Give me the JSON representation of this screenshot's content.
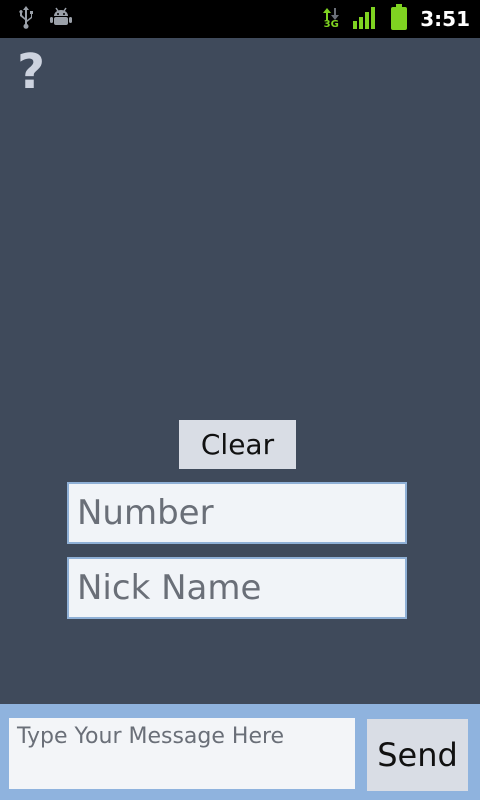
{
  "status_bar": {
    "time": "3:51",
    "network_type": "3G",
    "icons": [
      "usb-icon",
      "debug-icon",
      "data-arrows-icon",
      "signal-icon",
      "battery-icon"
    ],
    "accent_green": "#7fd321"
  },
  "help": {
    "label": "?"
  },
  "form": {
    "clear_label": "Clear",
    "number_placeholder": "Number",
    "nickname_placeholder": "Nick Name"
  },
  "composer": {
    "message_placeholder": "Type Your Message Here",
    "send_label": "Send"
  },
  "colors": {
    "background": "#3f4a5b",
    "bottom_bar": "#8fb3de",
    "button": "#d9dde5",
    "field_border": "#8fb0d6"
  }
}
